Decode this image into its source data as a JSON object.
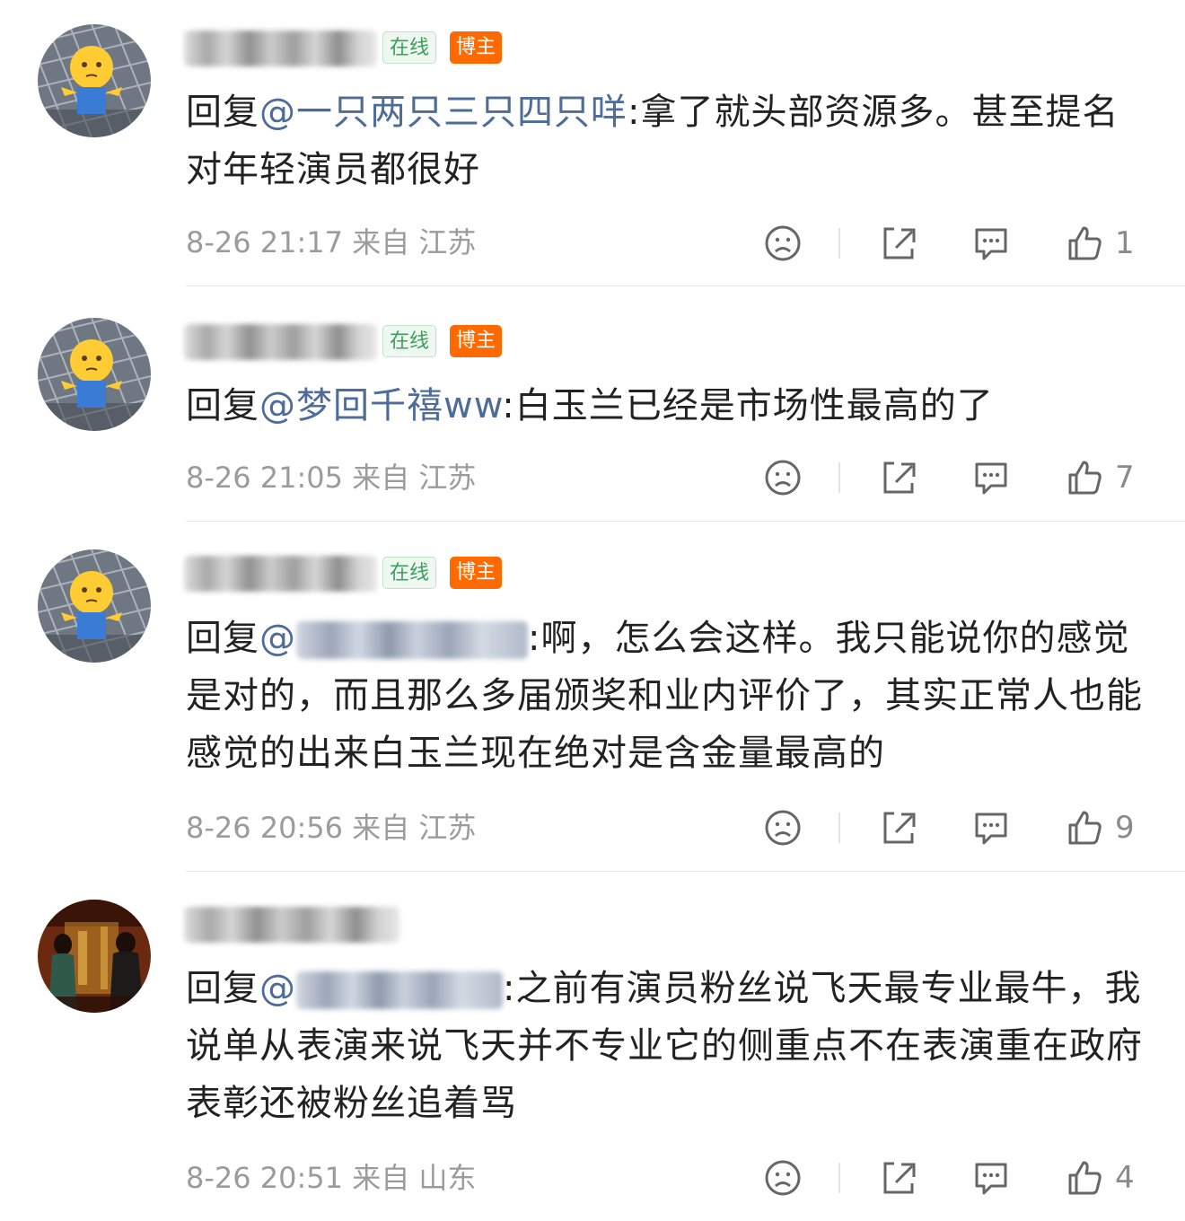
{
  "badges": {
    "online": "在线",
    "blogger": "博主"
  },
  "comments": [
    {
      "reply_prefix": "回复",
      "mention": "@一只两只三只四只咩",
      "body": ":拿了就头部资源多。甚至提名对年轻演员都很好",
      "time": "8-26 21:17",
      "from": "来自",
      "location": "江苏",
      "likes": "1",
      "avatar": "emoji-avatar"
    },
    {
      "reply_prefix": "回复",
      "mention": "@梦回千禧ww",
      "body": ":白玉兰已经是市场性最高的了",
      "time": "8-26 21:05",
      "from": "来自",
      "location": "江苏",
      "likes": "7",
      "avatar": "emoji-avatar"
    },
    {
      "reply_prefix": "回复",
      "mention": "@",
      "body": ":啊，怎么会这样。我只能说你的感觉是对的，而且那么多届颁奖和业内评价了，其实正常人也能感觉的出来白玉兰现在绝对是含金量最高的",
      "time": "8-26 20:56",
      "from": "来自",
      "location": "江苏",
      "likes": "9",
      "avatar": "emoji-avatar"
    },
    {
      "reply_prefix": "回复",
      "mention": "@",
      "body": ":之前有演员粉丝说飞天最专业最牛，我说单从表演来说飞天并不专业它的侧重点不在表演重在政府表彰还被粉丝追着骂",
      "time": "8-26 20:51",
      "from": "来自",
      "location": "山东",
      "likes": "4",
      "avatar": "movie-poster-avatar"
    }
  ],
  "icons": {
    "dislike": "sad-face-icon",
    "share": "share-icon",
    "comment": "comment-bubble-icon",
    "like": "thumbs-up-icon"
  },
  "colors": {
    "mention": "#4e6c99",
    "online_badge": "#3aa05a",
    "blogger_badge": "#ff6a00",
    "meta_text": "#9b9b9b"
  }
}
